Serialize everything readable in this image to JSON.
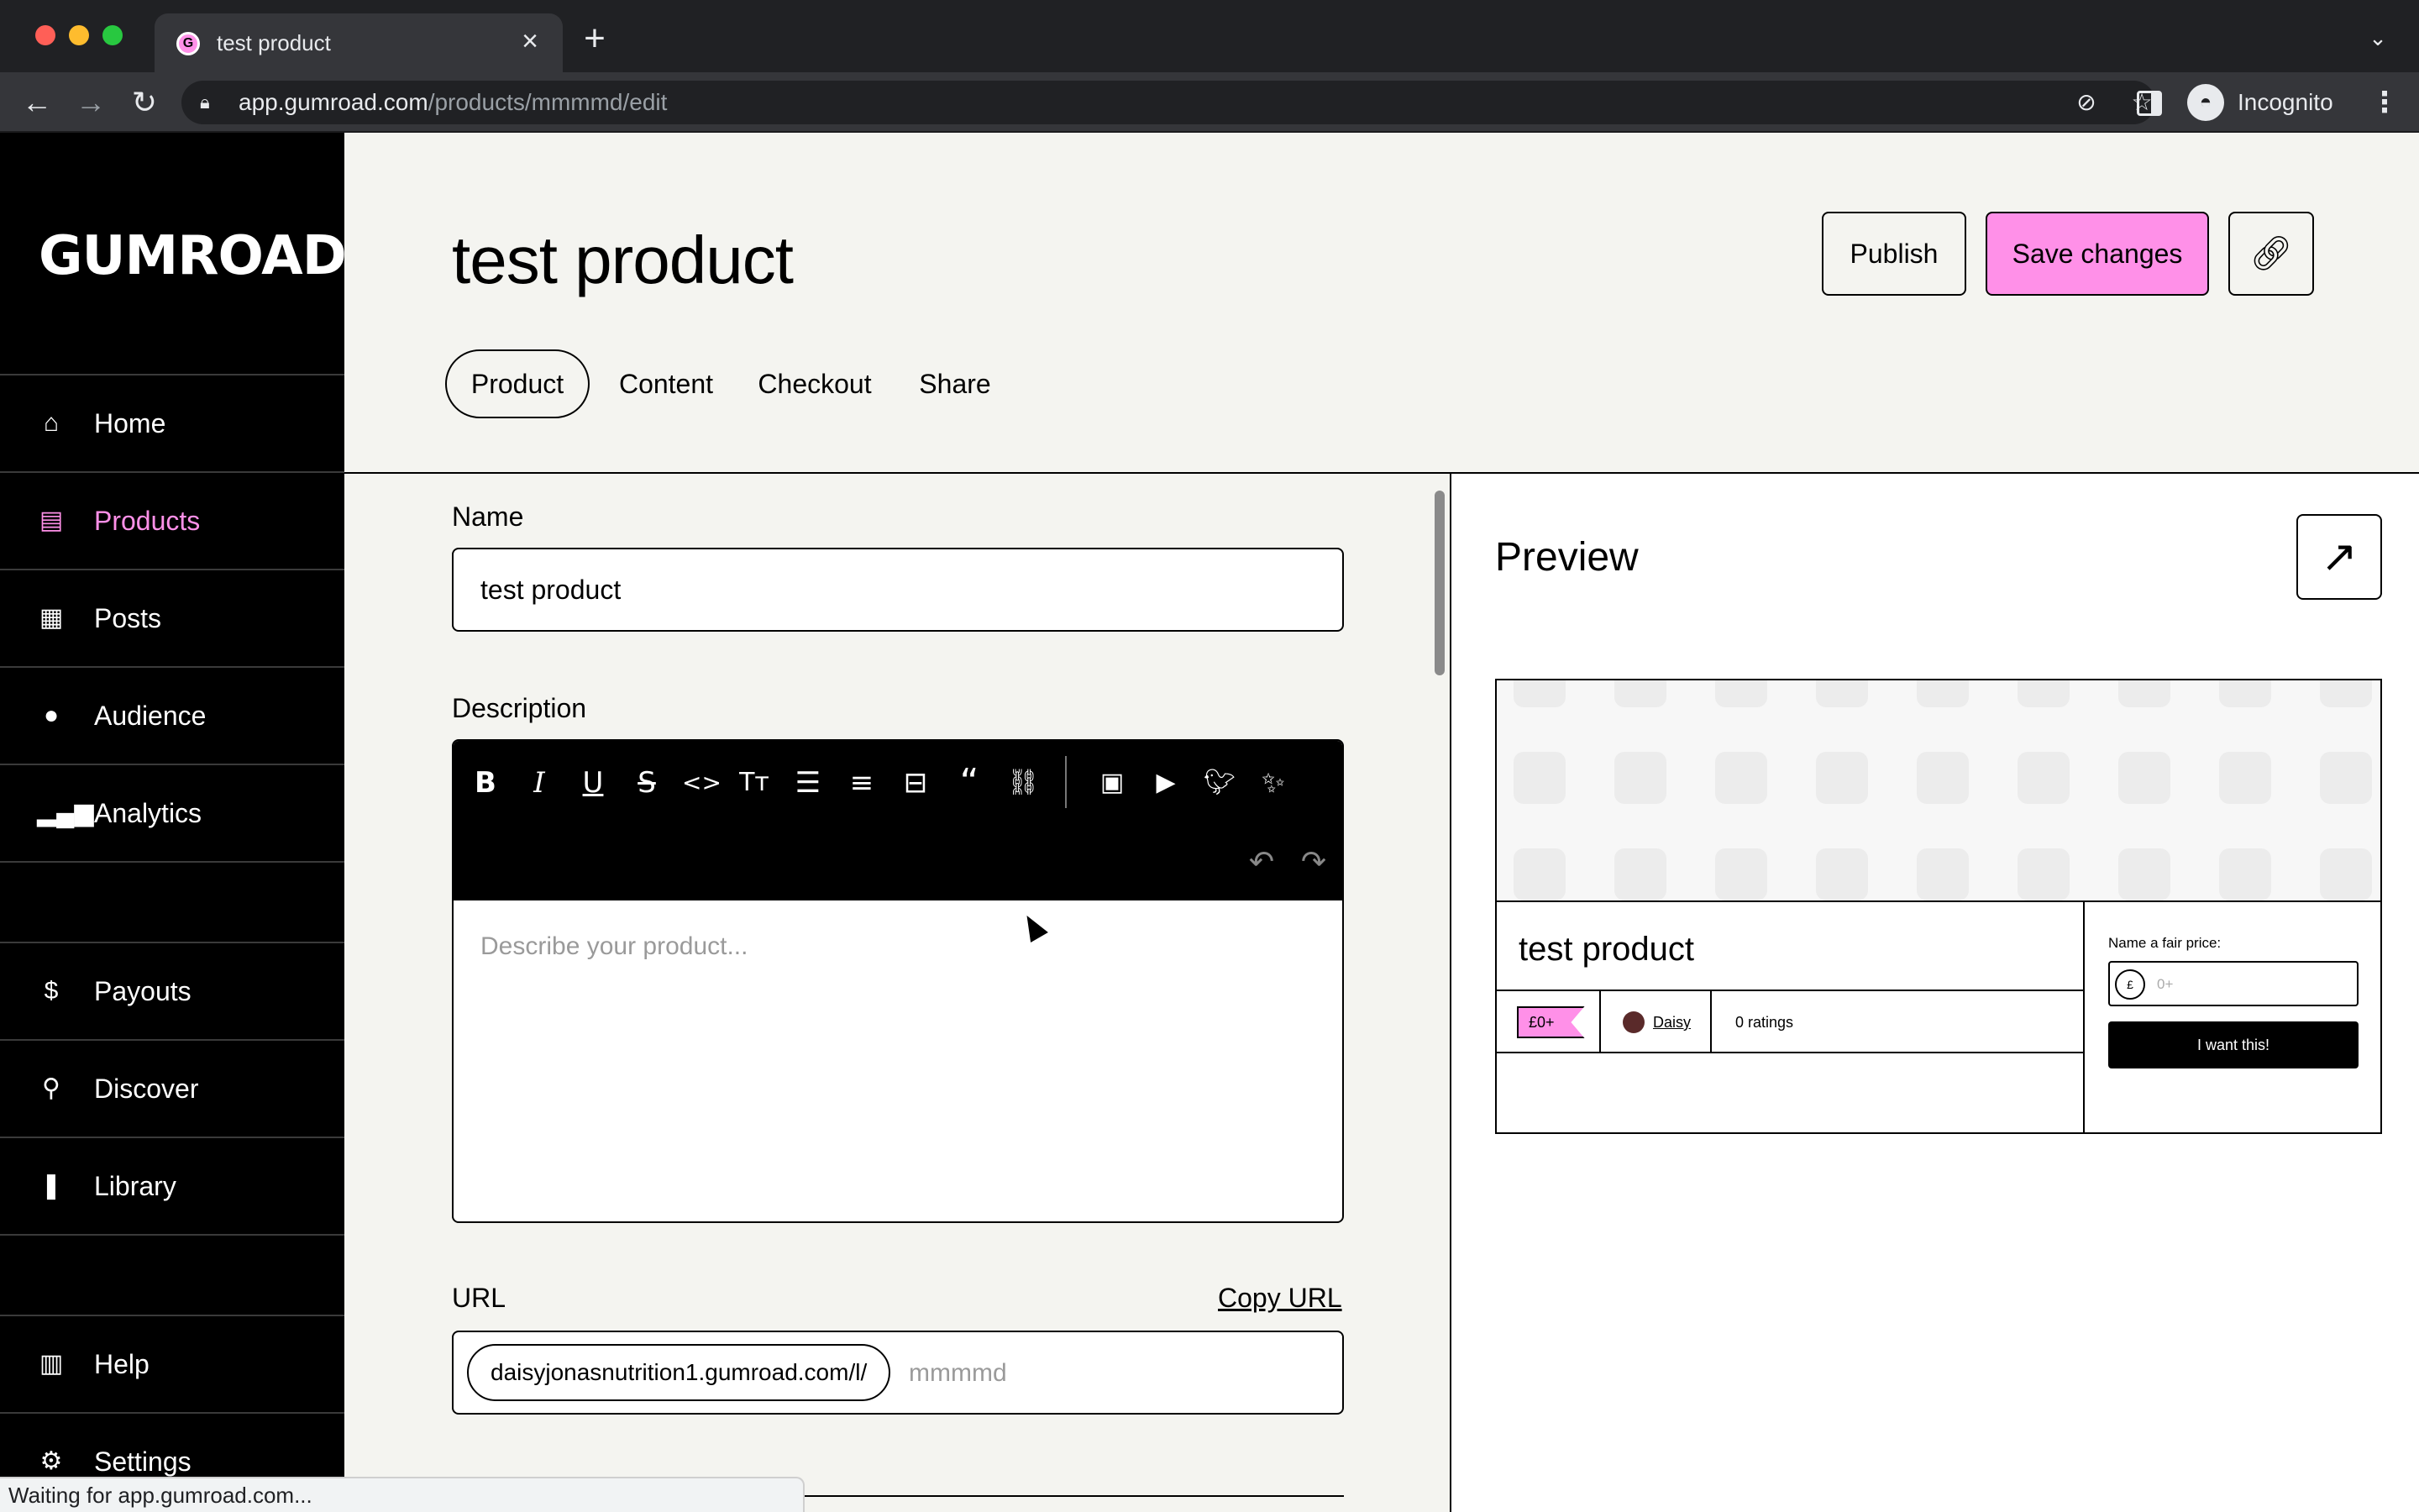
{
  "browser": {
    "tab_title": "test product",
    "favicon_letter": "G",
    "url_domain": "app.gumroad.com",
    "url_path": "/products/mmmmd/edit",
    "profile_label": "Incognito",
    "status_text": "Waiting for app.gumroad.com..."
  },
  "sidebar": {
    "logo": "GUMROAD",
    "items": [
      {
        "label": "Home",
        "icon": "store-icon"
      },
      {
        "label": "Products",
        "icon": "archive-icon"
      },
      {
        "label": "Posts",
        "icon": "document-icon"
      },
      {
        "label": "Audience",
        "icon": "people-icon"
      },
      {
        "label": "Analytics",
        "icon": "bar-chart-icon"
      },
      {
        "label": "Payouts",
        "icon": "dollar-icon"
      },
      {
        "label": "Discover",
        "icon": "search-icon"
      },
      {
        "label": "Library",
        "icon": "bookmark-icon"
      },
      {
        "label": "Help",
        "icon": "book-icon"
      },
      {
        "label": "Settings",
        "icon": "gear-icon"
      }
    ],
    "active": "Products"
  },
  "header": {
    "title": "test product",
    "publish_label": "Publish",
    "save_label": "Save changes",
    "tabs": [
      "Product",
      "Content",
      "Checkout",
      "Share"
    ],
    "active_tab": "Product"
  },
  "form": {
    "name_label": "Name",
    "name_value": "test product",
    "description_label": "Description",
    "description_placeholder": "Describe your product...",
    "url_label": "URL",
    "copy_url_label": "Copy URL",
    "url_prefix": "daisyjonasnutrition1.gumroad.com/l/",
    "url_slug_placeholder": "mmmmd"
  },
  "preview": {
    "title": "Preview",
    "product_title": "test product",
    "price_tag": "£0+",
    "author": "Daisy",
    "ratings": "0 ratings",
    "fair_price_label": "Name a fair price:",
    "currency_symbol": "£",
    "price_placeholder": "0+",
    "buy_label": "I want this!"
  },
  "colors": {
    "accent_pink": "#ff90e8",
    "sidebar_bg": "#000000",
    "page_bg": "#f4f4f0"
  }
}
